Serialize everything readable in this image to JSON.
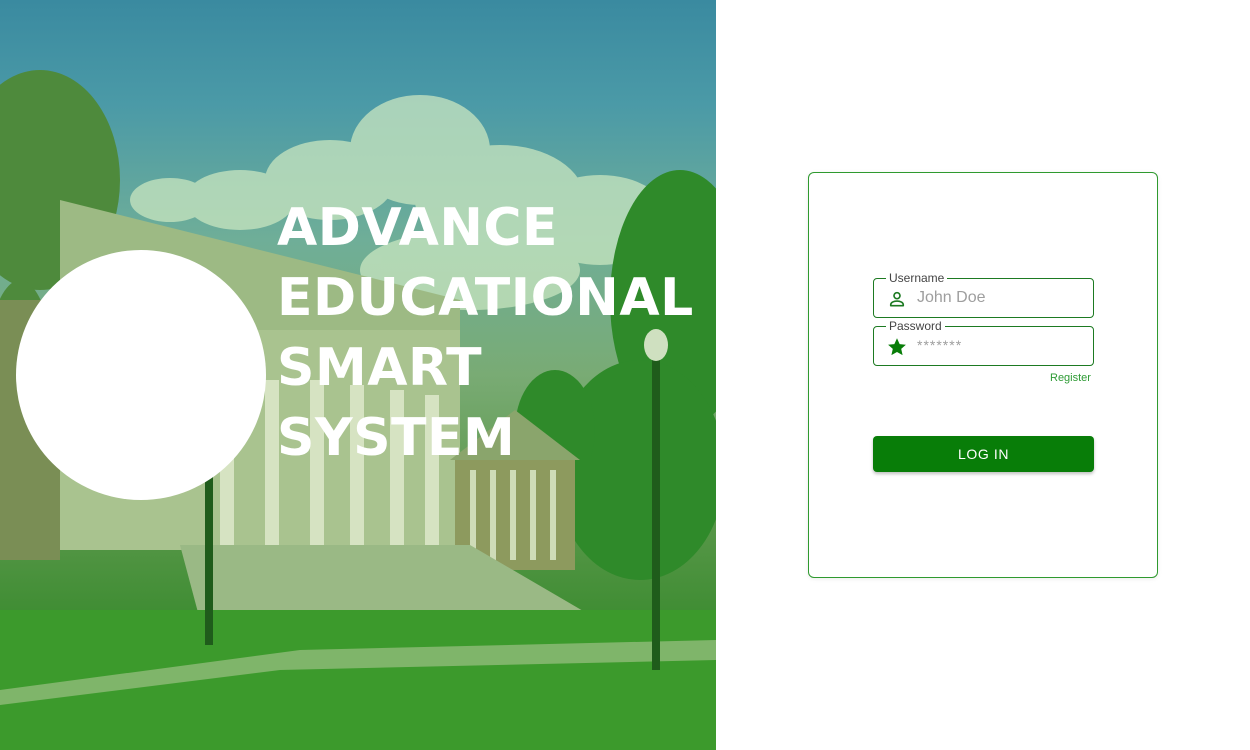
{
  "hero": {
    "title_lines": [
      "ADVANCE",
      "EDUCATIONAL",
      "SMART",
      "SYSTEM"
    ]
  },
  "login": {
    "username": {
      "label": "Username",
      "placeholder": "John Doe",
      "value": "",
      "icon": "person-icon"
    },
    "password": {
      "label": "Password",
      "placeholder": "*******",
      "value": "",
      "icon": "star-icon"
    },
    "register_link": "Register",
    "login_button": "LOG IN"
  },
  "colors": {
    "brand_green": "#087d08",
    "field_border": "#1d7a22",
    "link_green": "#2e9b35",
    "card_border": "#2f9a2f"
  }
}
